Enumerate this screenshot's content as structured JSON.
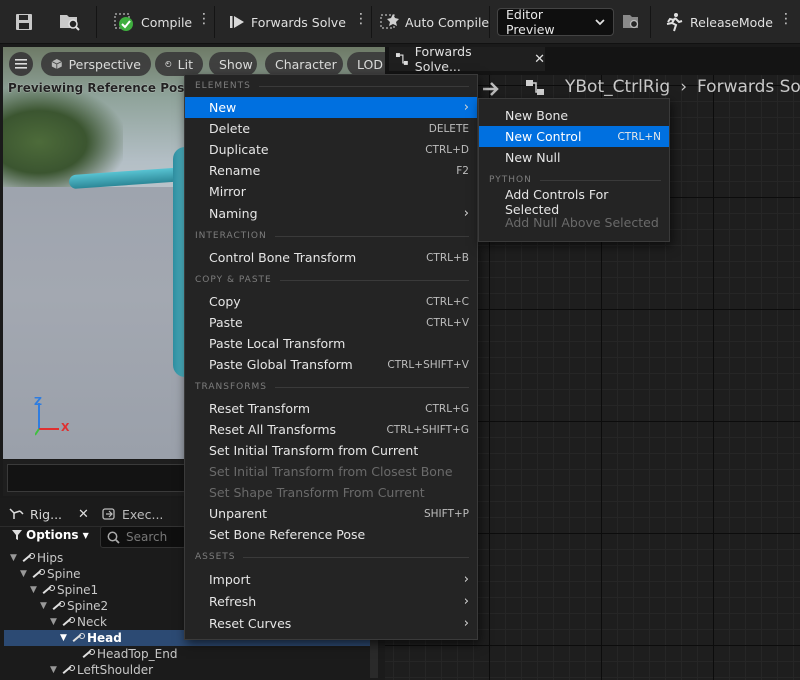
{
  "toolbar": {
    "compile": "Compile",
    "forwards_solve": "Forwards Solve",
    "auto_compile": "Auto Compile",
    "editor_preview": "Editor Preview",
    "release_mode": "ReleaseMode"
  },
  "viewport": {
    "perspective": "Perspective",
    "lit": "Lit",
    "show": "Show",
    "character": "Character",
    "lod": "LOD",
    "previewing": "Previewing Reference Pose",
    "axis_z": "Z",
    "axis_x": "X"
  },
  "right_panel": {
    "tab_title": "Forwards Solve...",
    "breadcrumb_asset": "YBot_CtrlRig",
    "breadcrumb_graph": "Forwards So"
  },
  "rig_panel": {
    "tab_rig": "Rig...",
    "tab_exec": "Exec...",
    "options": "Options",
    "search_placeholder": "Search",
    "tree": [
      {
        "label": "Hips",
        "depth": 0,
        "selected": false
      },
      {
        "label": "Spine",
        "depth": 1,
        "selected": false
      },
      {
        "label": "Spine1",
        "depth": 2,
        "selected": false
      },
      {
        "label": "Spine2",
        "depth": 3,
        "selected": false
      },
      {
        "label": "Neck",
        "depth": 4,
        "selected": false
      },
      {
        "label": "Head",
        "depth": 5,
        "selected": true
      },
      {
        "label": "HeadTop_End",
        "depth": 6,
        "selected": false
      },
      {
        "label": "LeftShoulder",
        "depth": 4,
        "selected": false
      }
    ]
  },
  "context_menu": {
    "sections": {
      "elements": "ELEMENTS",
      "interaction": "INTERACTION",
      "copy_paste": "COPY & PASTE",
      "transforms": "TRANSFORMS",
      "assets": "ASSETS"
    },
    "new": "New",
    "delete": {
      "label": "Delete",
      "shortcut": "DELETE"
    },
    "duplicate": {
      "label": "Duplicate",
      "shortcut": "CTRL+D"
    },
    "rename": {
      "label": "Rename",
      "shortcut": "F2"
    },
    "mirror": "Mirror",
    "naming": "Naming",
    "control_bone_transform": {
      "label": "Control Bone Transform",
      "shortcut": "CTRL+B"
    },
    "copy": {
      "label": "Copy",
      "shortcut": "CTRL+C"
    },
    "paste": {
      "label": "Paste",
      "shortcut": "CTRL+V"
    },
    "paste_local": "Paste Local Transform",
    "paste_global": {
      "label": "Paste Global Transform",
      "shortcut": "CTRL+SHIFT+V"
    },
    "reset_transform": {
      "label": "Reset Transform",
      "shortcut": "CTRL+G"
    },
    "reset_all_transforms": {
      "label": "Reset All Transforms",
      "shortcut": "CTRL+SHIFT+G"
    },
    "set_initial_current": "Set Initial Transform from Current",
    "set_initial_closest": "Set Initial Transform from Closest Bone",
    "set_shape_current": "Set Shape Transform From Current",
    "unparent": {
      "label": "Unparent",
      "shortcut": "SHIFT+P"
    },
    "set_bone_ref_pose": "Set Bone Reference Pose",
    "import": "Import",
    "refresh": "Refresh",
    "reset_curves": "Reset Curves"
  },
  "submenu": {
    "new_bone": "New Bone",
    "new_control": {
      "label": "New Control",
      "shortcut": "CTRL+N"
    },
    "new_null": "New Null",
    "python": "PYTHON",
    "add_controls_for_selected": "Add Controls For Selected",
    "add_null_above_selected": "Add Null Above Selected"
  },
  "colors": {
    "highlight": "#0070e0",
    "selected_row": "#2c4a73",
    "character": "#4bb8c8"
  }
}
